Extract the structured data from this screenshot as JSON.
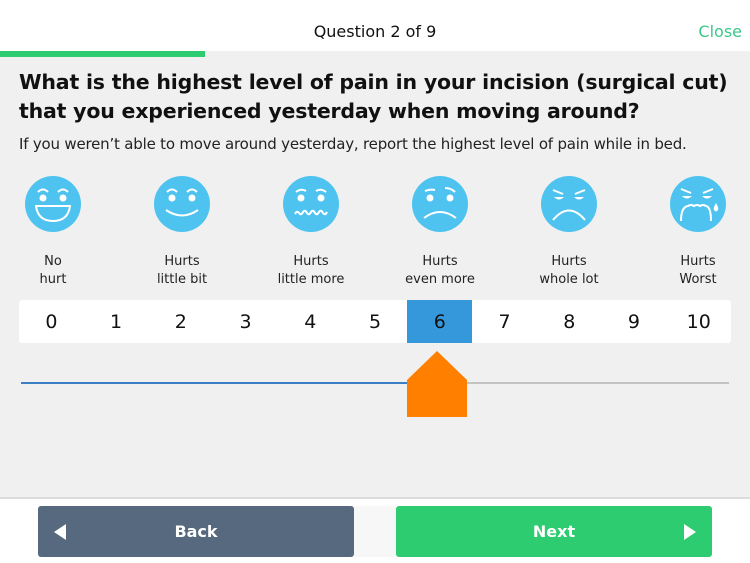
{
  "header": {
    "title": "Question 2 of 9",
    "close_label": "Close",
    "progress_fraction": 0.273,
    "accent_color": "#2ecc71"
  },
  "question": {
    "text": "What is the highest level of pain in your incision (surgical cut) that you experienced yesterday when moving around?",
    "hint": "If you weren’t able to move around yesterday, report the highest level of pain while in bed."
  },
  "faces": [
    {
      "icon": "face-laughing-icon",
      "line1": "No",
      "line2": "hurt"
    },
    {
      "icon": "face-smiling-icon",
      "line1": "Hurts",
      "line2": "little bit"
    },
    {
      "icon": "face-wavy-mouth-icon",
      "line1": "Hurts",
      "line2": "little more"
    },
    {
      "icon": "face-frowning-icon",
      "line1": "Hurts",
      "line2": "even more"
    },
    {
      "icon": "face-squinting-frown-icon",
      "line1": "Hurts",
      "line2": "whole lot"
    },
    {
      "icon": "face-crying-icon",
      "line1": "Hurts",
      "line2": "Worst"
    }
  ],
  "face_color": "#4ec3ef",
  "scale": {
    "values": [
      "0",
      "1",
      "2",
      "3",
      "4",
      "5",
      "6",
      "7",
      "8",
      "9",
      "10"
    ],
    "selected": 6,
    "min": 0,
    "max": 10,
    "selected_color": "#3498db",
    "thumb_color": "#ff7f00"
  },
  "footer": {
    "back_label": "Back",
    "next_label": "Next",
    "back_color": "#56697e",
    "next_color": "#2ecc71"
  }
}
